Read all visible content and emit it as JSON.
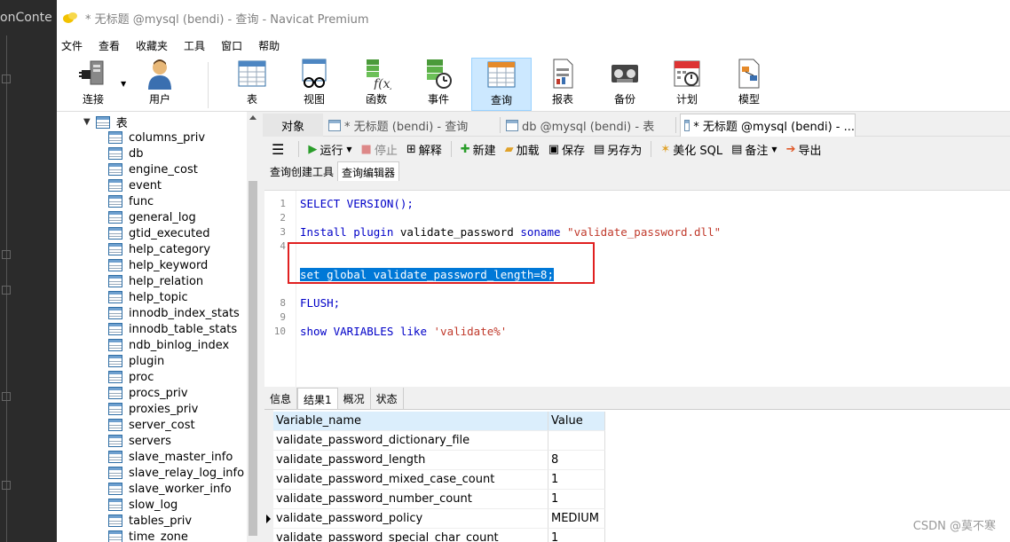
{
  "background_app": {
    "fragment": "onConte"
  },
  "window": {
    "title": "* 无标题 @mysql (bendi) - 查询 - Navicat Premium"
  },
  "menu": [
    "文件",
    "查看",
    "收藏夹",
    "工具",
    "窗口",
    "帮助"
  ],
  "toolbar": [
    {
      "label": "连接",
      "icon": "plug-icon"
    },
    {
      "label": "用户",
      "icon": "user-icon"
    },
    {
      "label": "表",
      "icon": "table-icon"
    },
    {
      "label": "视图",
      "icon": "view-icon"
    },
    {
      "label": "函数",
      "icon": "function-icon"
    },
    {
      "label": "事件",
      "icon": "event-icon"
    },
    {
      "label": "查询",
      "icon": "query-icon",
      "active": true
    },
    {
      "label": "报表",
      "icon": "report-icon"
    },
    {
      "label": "备份",
      "icon": "backup-icon"
    },
    {
      "label": "计划",
      "icon": "schedule-icon"
    },
    {
      "label": "模型",
      "icon": "model-icon"
    }
  ],
  "sidebar": {
    "parent": "表",
    "tables": [
      "columns_priv",
      "db",
      "engine_cost",
      "event",
      "func",
      "general_log",
      "gtid_executed",
      "help_category",
      "help_keyword",
      "help_relation",
      "help_topic",
      "innodb_index_stats",
      "innodb_table_stats",
      "ndb_binlog_index",
      "plugin",
      "proc",
      "procs_priv",
      "proxies_priv",
      "server_cost",
      "servers",
      "slave_master_info",
      "slave_relay_log_info",
      "slave_worker_info",
      "slow_log",
      "tables_priv",
      "time_zone"
    ]
  },
  "tabs": {
    "objects": "对象",
    "items": [
      "* 无标题 (bendi) - 查询",
      "db @mysql (bendi) - 表",
      "* 无标题 @mysql (bendi) - ..."
    ]
  },
  "query_toolbar": {
    "run": "运行",
    "stop": "停止",
    "explain": "解释",
    "new": "新建",
    "load": "加载",
    "save": "保存",
    "save_as": "另存为",
    "beautify": "美化 SQL",
    "comment": "备注",
    "export": "导出"
  },
  "sub_tabs": [
    "查询创建工具",
    "查询编辑器"
  ],
  "editor": {
    "lines": [
      {
        "n": "1",
        "text": "SELECT VERSION();"
      },
      {
        "n": "2",
        "text": ""
      },
      {
        "n": "3",
        "text": "Install plugin validate_password soname \"validate_password.dll\""
      },
      {
        "n": "4",
        "text": ""
      },
      {
        "n": "5",
        "text": ""
      },
      {
        "n": "6",
        "text": "set global validate_password_length=8;"
      },
      {
        "n": "7",
        "text": ""
      },
      {
        "n": "8",
        "text": "FLUSH;"
      },
      {
        "n": "9",
        "text": ""
      },
      {
        "n": "10",
        "text": "show VARIABLES like 'validate%'"
      }
    ]
  },
  "result_tabs": [
    "信息",
    "结果1",
    "概况",
    "状态"
  ],
  "grid": {
    "columns": [
      "Variable_name",
      "Value"
    ],
    "rows": [
      [
        "validate_password_dictionary_file",
        ""
      ],
      [
        "validate_password_length",
        "8"
      ],
      [
        "validate_password_mixed_case_count",
        "1"
      ],
      [
        "validate_password_number_count",
        "1"
      ],
      [
        "validate_password_policy",
        "MEDIUM"
      ],
      [
        "validate_password_special_char_count",
        "1"
      ]
    ]
  },
  "watermark": "CSDN @莫不寒"
}
